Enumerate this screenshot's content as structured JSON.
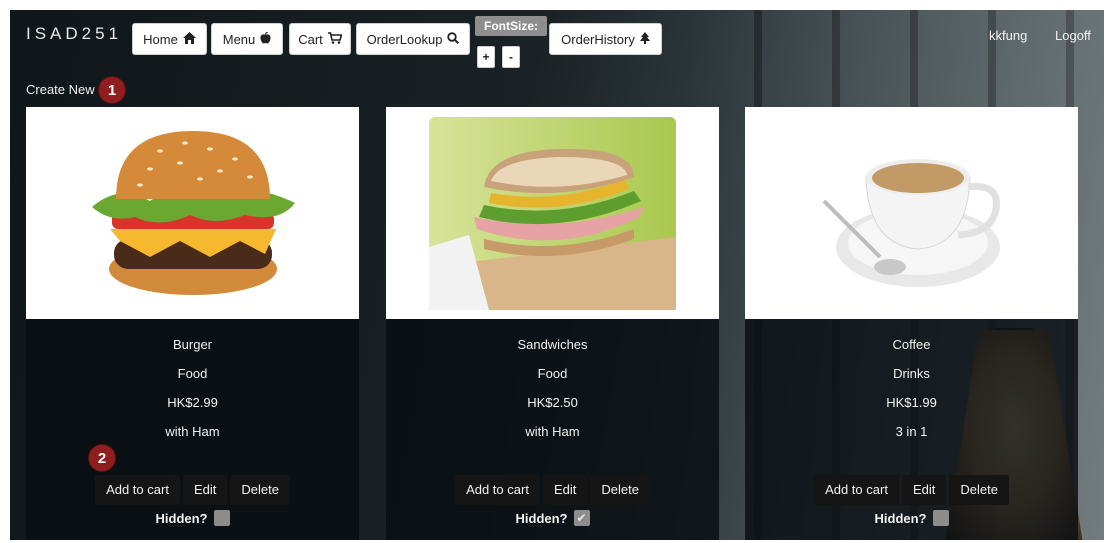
{
  "nav": {
    "brand": "ISAD251",
    "home": "Home",
    "menu": "Menu",
    "cart": "Cart",
    "order_lookup": "OrderLookup",
    "font_size_label": "FontSize:",
    "font_plus": "+",
    "font_minus": "-",
    "order_history": "OrderHistory",
    "username": "kkfung",
    "logoff": "Logoff"
  },
  "create_new": "Create New",
  "markers": [
    "1",
    "2"
  ],
  "cards": [
    {
      "name": "Burger",
      "category": "Food",
      "price": "HK$2.99",
      "note": "with Ham",
      "actions": [
        "Add to cart",
        "Edit",
        "Delete"
      ],
      "hidden_label": "Hidden?",
      "hidden": false
    },
    {
      "name": "Sandwiches",
      "category": "Food",
      "price": "HK$2.50",
      "note": "with Ham",
      "actions": [
        "Add to cart",
        "Edit",
        "Delete"
      ],
      "hidden_label": "Hidden?",
      "hidden": true
    },
    {
      "name": "Coffee",
      "category": "Drinks",
      "price": "HK$1.99",
      "note": "3 in 1",
      "actions": [
        "Add to cart",
        "Edit",
        "Delete"
      ],
      "hidden_label": "Hidden?",
      "hidden": false
    }
  ],
  "icons": {
    "home": "home-icon",
    "menu": "apple-icon",
    "cart": "cart-icon",
    "lookup": "search-icon",
    "history": "tree-icon"
  },
  "colors": {
    "marker": "#8f1e1e",
    "button_dark": "#151515"
  }
}
